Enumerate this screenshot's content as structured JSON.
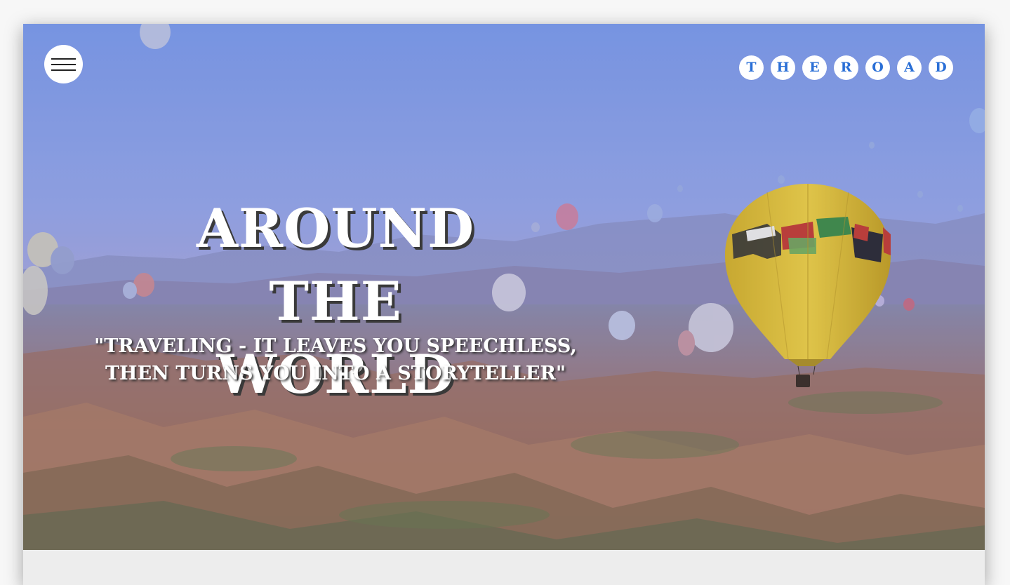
{
  "menu": {
    "icon": "hamburger-menu-icon"
  },
  "brand": {
    "letters": [
      "T",
      "H",
      "E",
      "R",
      "O",
      "A",
      "D"
    ],
    "color": "#2a6fd6"
  },
  "hero": {
    "title_line1": "AROUND THE",
    "title_line2": "WORLD",
    "quote_line1": "\"TRAVELING - IT LEAVES YOU SPEECHLESS,",
    "quote_line2": "THEN TURNS YOU INTO A STORYTELLER\"",
    "image": "hot-air-balloons-over-canyon-landscape"
  }
}
